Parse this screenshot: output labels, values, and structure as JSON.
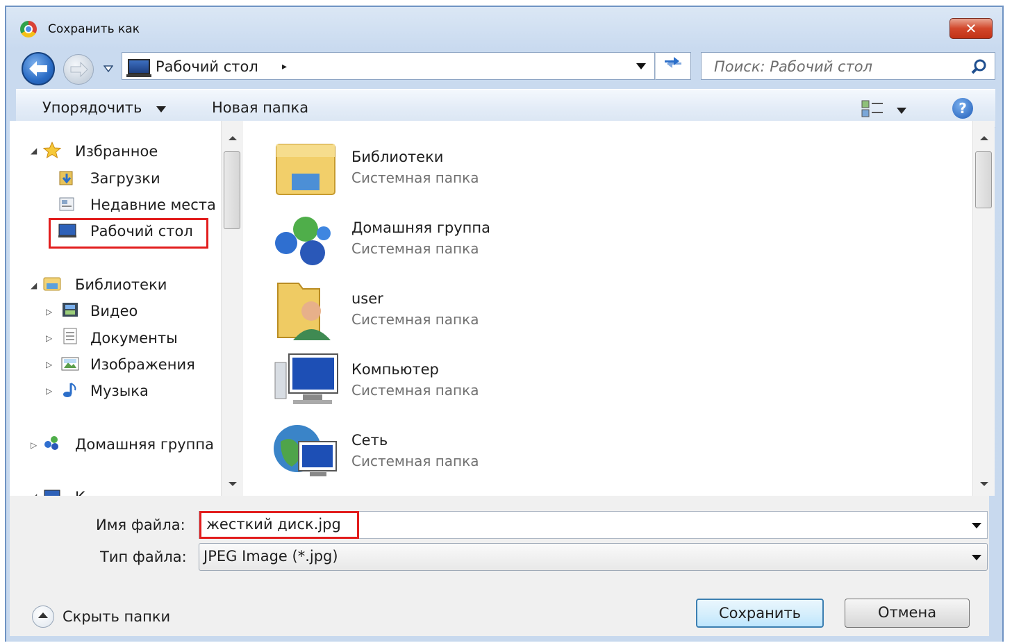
{
  "window": {
    "title": "Сохранить как",
    "close_label": "✕"
  },
  "nav": {
    "address": "Рабочий стол",
    "address_separator": "▸",
    "search_placeholder": "Поиск: Рабочий стол"
  },
  "toolbar": {
    "organize_label": "Упорядочить",
    "new_folder_label": "Новая папка",
    "help_label": "?"
  },
  "sidebar": {
    "favorites_label": "Избранное",
    "favorites": [
      {
        "label": "Загрузки"
      },
      {
        "label": "Недавние места"
      },
      {
        "label": "Рабочий стол",
        "selected": true
      }
    ],
    "libraries_label": "Библиотеки",
    "libraries": [
      {
        "label": "Видео"
      },
      {
        "label": "Документы"
      },
      {
        "label": "Изображения"
      },
      {
        "label": "Музыка"
      }
    ],
    "homegroup_label": "Домашняя группа",
    "computer_label_partial": "К"
  },
  "content": {
    "items": [
      {
        "name": "Библиотеки",
        "type": "Системная папка",
        "icon": "libraries-icon"
      },
      {
        "name": "Домашняя группа",
        "type": "Системная папка",
        "icon": "homegroup-icon"
      },
      {
        "name": "user",
        "type": "Системная папка",
        "icon": "user-folder-icon"
      },
      {
        "name": "Компьютер",
        "type": "Системная папка",
        "icon": "computer-icon"
      },
      {
        "name": "Сеть",
        "type": "Системная папка",
        "icon": "network-icon"
      }
    ]
  },
  "form": {
    "filename_label": "Имя файла:",
    "filename_value": "жесткий диск.jpg",
    "filetype_label": "Тип файла:",
    "filetype_value": "JPEG Image (*.jpg)"
  },
  "footer": {
    "hide_folders_label": "Скрыть папки",
    "save_label": "Сохранить",
    "cancel_label": "Отмена"
  },
  "colors": {
    "highlight": "#e21d1d",
    "window_frame": "#6f93c3",
    "accent_blue": "#2b6ec9"
  }
}
